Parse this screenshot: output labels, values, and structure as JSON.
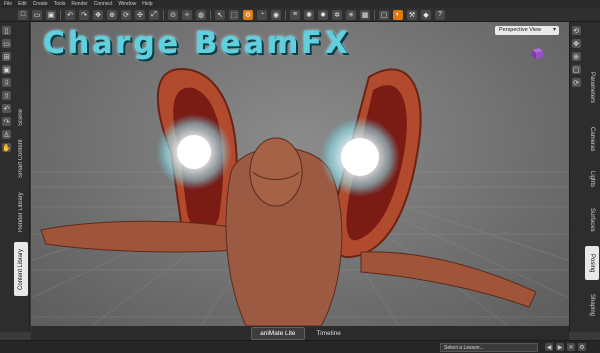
{
  "menu": [
    "File",
    "Edit",
    "Create",
    "Tools",
    "Render",
    "Connect",
    "Window",
    "Help"
  ],
  "viewport": {
    "overlay_title": "Charge BeamFX",
    "camera": "Perspective View"
  },
  "left_tabs": [
    "Scene",
    "Smart Content",
    "Render Library",
    "Content Library"
  ],
  "right_tabs": [
    "Parameters",
    "Cameras",
    "Lights",
    "Surfaces",
    "Posing",
    "Shaping"
  ],
  "bottom_tabs": [
    "aniMate Lite",
    "Timeline"
  ],
  "status": {
    "lesson_placeholder": "Select a Lesson..."
  },
  "colors": {
    "accent": "#e07a10",
    "title": "#5fd0dd"
  }
}
